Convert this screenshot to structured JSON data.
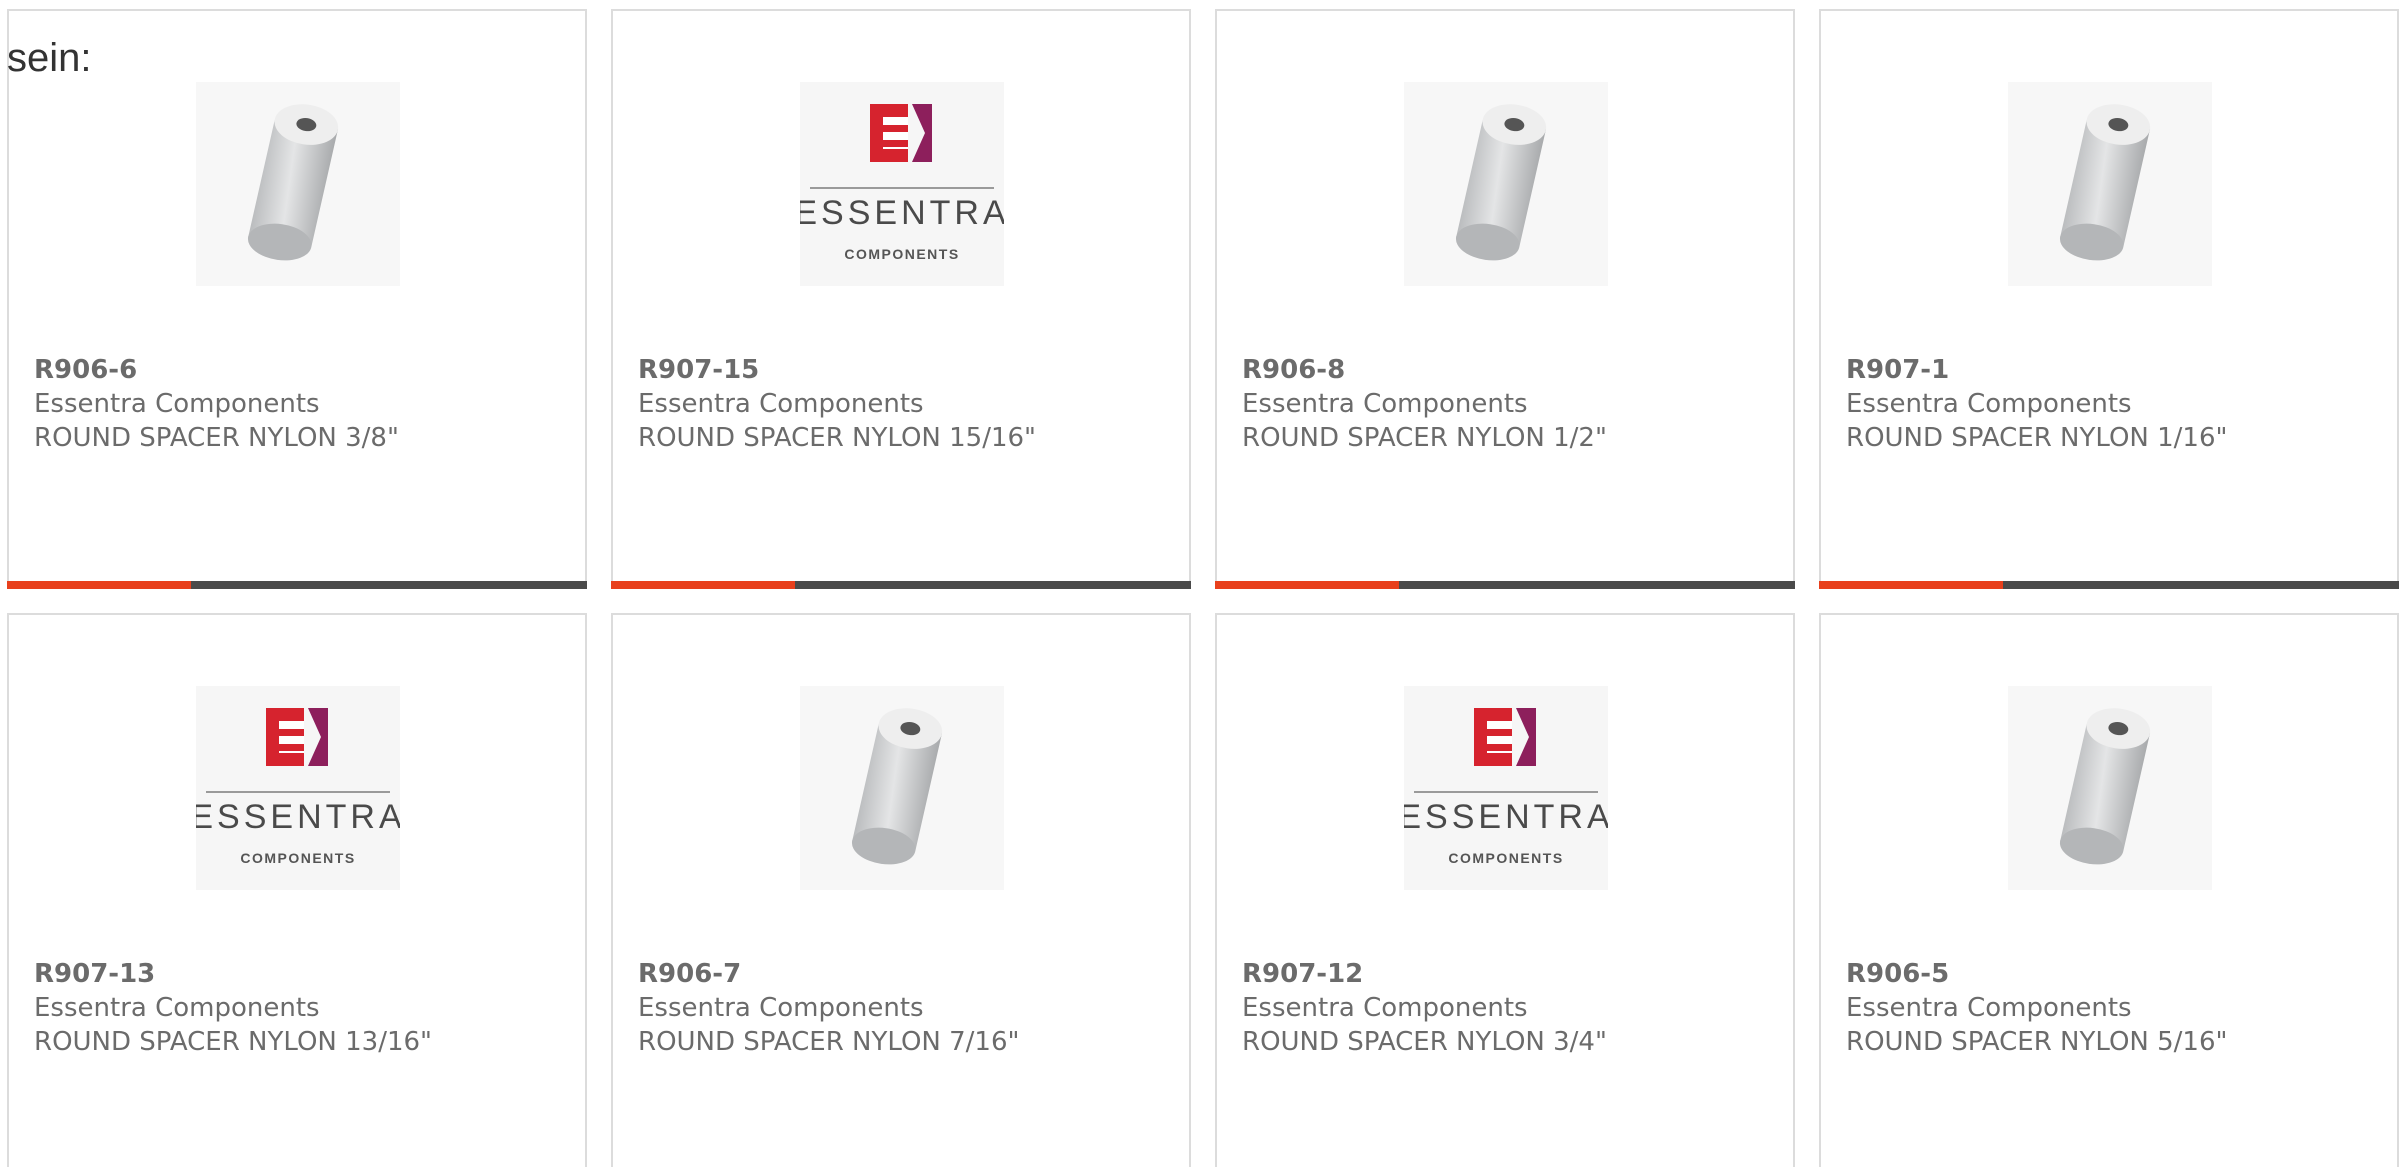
{
  "intro_text": "sein:",
  "accent_color": "#e8401c",
  "bar_color": "#4a4a4a",
  "products": [
    {
      "part": "R906-6",
      "maker": "Essentra Components",
      "desc": "ROUND SPACER NYLON 3/8\"",
      "image": "spacer-icon"
    },
    {
      "part": "R907-15",
      "maker": "Essentra Components",
      "desc": "ROUND SPACER NYLON 15/16\"",
      "image": "essentra-logo"
    },
    {
      "part": "R906-8",
      "maker": "Essentra Components",
      "desc": "ROUND SPACER NYLON 1/2\"",
      "image": "spacer-icon"
    },
    {
      "part": "R907-1",
      "maker": "Essentra Components",
      "desc": "ROUND SPACER NYLON 1/16\"",
      "image": "spacer-icon"
    },
    {
      "part": "R907-13",
      "maker": "Essentra Components",
      "desc": "ROUND SPACER NYLON 13/16\"",
      "image": "essentra-logo"
    },
    {
      "part": "R906-7",
      "maker": "Essentra Components",
      "desc": "ROUND SPACER NYLON 7/16\"",
      "image": "spacer-icon"
    },
    {
      "part": "R907-12",
      "maker": "Essentra Components",
      "desc": "ROUND SPACER NYLON 3/4\"",
      "image": "essentra-logo"
    },
    {
      "part": "R906-5",
      "maker": "Essentra Components",
      "desc": "ROUND SPACER NYLON 5/16\"",
      "image": "spacer-icon"
    }
  ],
  "logo": {
    "wordmark": "ESSENTRA",
    "sub": "COMPONENTS"
  }
}
